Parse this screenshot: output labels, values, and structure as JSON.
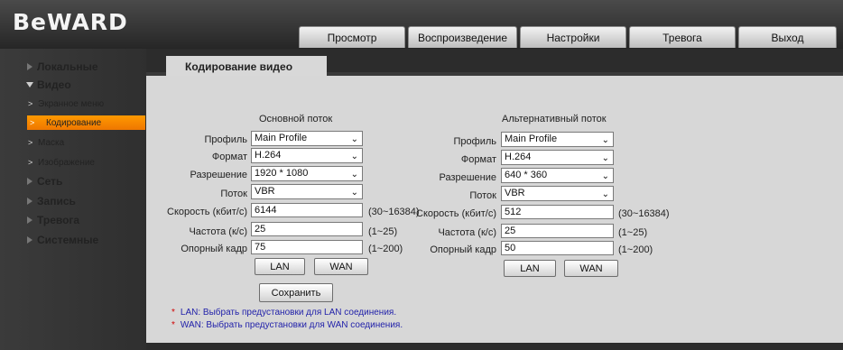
{
  "header": {
    "logo": "BeWARD",
    "tabs": [
      "Просмотр",
      "Воспроизведение",
      "Настройки",
      "Тревога",
      "Выход"
    ]
  },
  "sidebar": {
    "items": [
      {
        "label": "Локальные",
        "type": "main"
      },
      {
        "label": "Видео",
        "type": "main",
        "expanded": true
      },
      {
        "label": "Экранное меню",
        "type": "sub"
      },
      {
        "label": "Кодирование",
        "type": "sub",
        "active": true
      },
      {
        "label": "Маска",
        "type": "sub"
      },
      {
        "label": "Изображение",
        "type": "sub"
      },
      {
        "label": "Сеть",
        "type": "main"
      },
      {
        "label": "Запись",
        "type": "main"
      },
      {
        "label": "Тревога",
        "type": "main"
      },
      {
        "label": "Системные",
        "type": "main"
      }
    ]
  },
  "page": {
    "title": "Кодирование видео"
  },
  "labels": {
    "profile": "Профиль",
    "format": "Формат",
    "resolution": "Разрешение",
    "stream": "Поток",
    "bitrate": "Скорость (кбит/с)",
    "framerate": "Частота (к/с)",
    "keyframe": "Опорный кадр",
    "lan": "LAN",
    "wan": "WAN",
    "save": "Сохранить"
  },
  "main_stream": {
    "heading": "Основной поток",
    "profile": "Main Profile",
    "format": "H.264",
    "resolution": "1920 * 1080",
    "stream": "VBR",
    "bitrate": "6144",
    "bitrate_range": "(30~16384)",
    "framerate": "25",
    "framerate_range": "(1~25)",
    "keyframe": "75",
    "keyframe_range": "(1~200)"
  },
  "alt_stream": {
    "heading": "Альтернативный поток",
    "profile": "Main Profile",
    "format": "H.264",
    "resolution": "640 * 360",
    "stream": "VBR",
    "bitrate": "512",
    "bitrate_range": "(30~16384)",
    "framerate": "25",
    "framerate_range": "(1~25)",
    "keyframe": "50",
    "keyframe_range": "(1~200)"
  },
  "notes": {
    "star": "*",
    "lan": "LAN: Выбрать предустановки для LAN соединения.",
    "wan": "WAN: Выбрать предустановки для WAN соединения."
  },
  "icons": {
    "select_arrow": "chevron-down-icon",
    "nav_arrow": "chevron-right-icon"
  },
  "colors": {
    "accent": "#ff8a00",
    "note_text": "#2222aa",
    "note_star": "#d00000"
  }
}
